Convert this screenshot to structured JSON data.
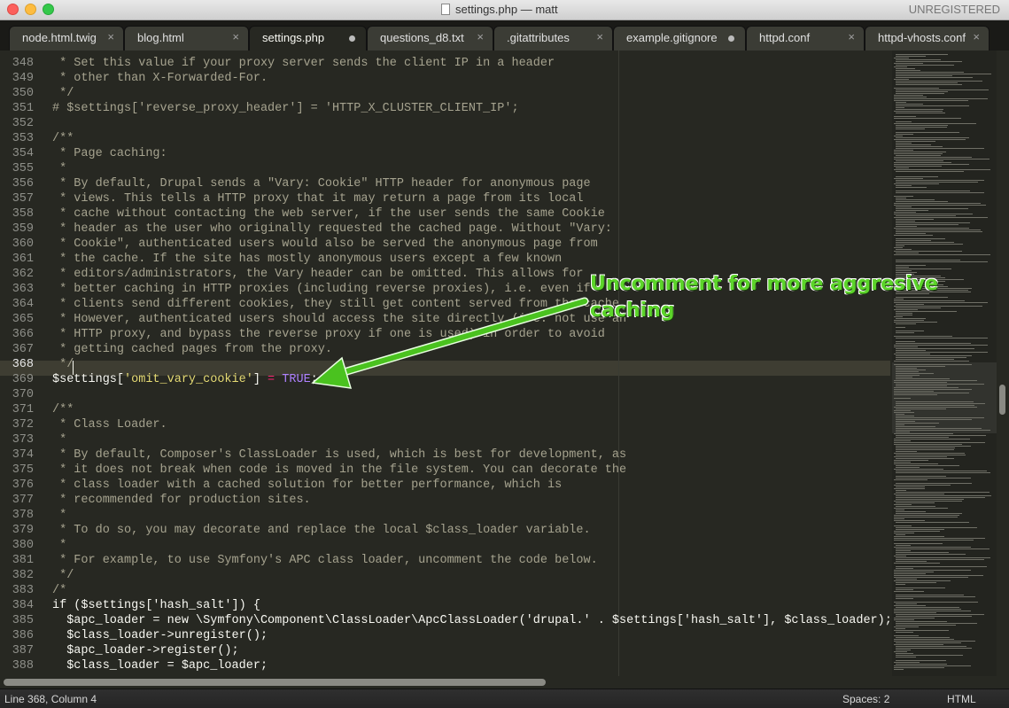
{
  "window": {
    "title": "settings.php — matt",
    "license": "UNREGISTERED"
  },
  "tabs": [
    {
      "label": "node.html.twig",
      "state": "close"
    },
    {
      "label": "blog.html",
      "state": "close"
    },
    {
      "label": "settings.php",
      "state": "modified"
    },
    {
      "label": "questions_d8.txt",
      "state": "close"
    },
    {
      "label": ".gitattributes",
      "state": "close"
    },
    {
      "label": "example.gitignore",
      "state": "modified"
    },
    {
      "label": "httpd.conf",
      "state": "close"
    },
    {
      "label": "httpd-vhosts.conf",
      "state": "close"
    }
  ],
  "editor": {
    "current_line": 368,
    "lines": [
      {
        "n": "348",
        "t": " * Set this value if your proxy server sends the client IP in a header"
      },
      {
        "n": "349",
        "t": " * other than X-Forwarded-For."
      },
      {
        "n": "350",
        "t": " */"
      },
      {
        "n": "351",
        "t": "# $settings['reverse_proxy_header'] = 'HTTP_X_CLUSTER_CLIENT_IP';"
      },
      {
        "n": "352",
        "t": ""
      },
      {
        "n": "353",
        "t": "/**"
      },
      {
        "n": "354",
        "t": " * Page caching:"
      },
      {
        "n": "355",
        "t": " *"
      },
      {
        "n": "356",
        "t": " * By default, Drupal sends a \"Vary: Cookie\" HTTP header for anonymous page"
      },
      {
        "n": "357",
        "t": " * views. This tells a HTTP proxy that it may return a page from its local"
      },
      {
        "n": "358",
        "t": " * cache without contacting the web server, if the user sends the same Cookie"
      },
      {
        "n": "359",
        "t": " * header as the user who originally requested the cached page. Without \"Vary:"
      },
      {
        "n": "360",
        "t": " * Cookie\", authenticated users would also be served the anonymous page from"
      },
      {
        "n": "361",
        "t": " * the cache. If the site has mostly anonymous users except a few known"
      },
      {
        "n": "362",
        "t": " * editors/administrators, the Vary header can be omitted. This allows for"
      },
      {
        "n": "363",
        "t": " * better caching in HTTP proxies (including reverse proxies), i.e. even if"
      },
      {
        "n": "364",
        "t": " * clients send different cookies, they still get content served from the cache."
      },
      {
        "n": "365",
        "t": " * However, authenticated users should access the site directly (i.e. not use an"
      },
      {
        "n": "366",
        "t": " * HTTP proxy, and bypass the reverse proxy if one is used) in order to avoid"
      },
      {
        "n": "367",
        "t": " * getting cached pages from the proxy."
      },
      {
        "n": "368",
        "t": " */"
      },
      {
        "n": "369",
        "code": true,
        "var": "$settings[",
        "str": "'omit_vary_cookie'",
        "close": "] ",
        "op": "=",
        "val": "TRUE",
        "end": ";"
      },
      {
        "n": "370",
        "t": ""
      },
      {
        "n": "371",
        "t": "/**"
      },
      {
        "n": "372",
        "t": " * Class Loader."
      },
      {
        "n": "373",
        "t": " *"
      },
      {
        "n": "374",
        "t": " * By default, Composer's ClassLoader is used, which is best for development, as"
      },
      {
        "n": "375",
        "t": " * it does not break when code is moved in the file system. You can decorate the"
      },
      {
        "n": "376",
        "t": " * class loader with a cached solution for better performance, which is"
      },
      {
        "n": "377",
        "t": " * recommended for production sites."
      },
      {
        "n": "378",
        "t": " *"
      },
      {
        "n": "379",
        "t": " * To do so, you may decorate and replace the local $class_loader variable."
      },
      {
        "n": "380",
        "t": " *"
      },
      {
        "n": "381",
        "t": " * For example, to use Symfony's APC class loader, uncomment the code below."
      },
      {
        "n": "382",
        "t": " */"
      },
      {
        "n": "383",
        "t": "/*"
      },
      {
        "n": "384",
        "t": "if ($settings['hash_salt']) {"
      },
      {
        "n": "385",
        "t": "  $apc_loader = new \\Symfony\\Component\\ClassLoader\\ApcClassLoader('drupal.' . $settings['hash_salt'], $class_loader);"
      },
      {
        "n": "386",
        "t": "  $class_loader->unregister();"
      },
      {
        "n": "387",
        "t": "  $apc_loader->register();"
      },
      {
        "n": "388",
        "t": "  $class_loader = $apc_loader;"
      }
    ]
  },
  "annotation": {
    "text": "Uncomment for more aggresive caching",
    "color": "#5cd42a"
  },
  "statusbar": {
    "position": "Line 368, Column 4",
    "indent": "Spaces: 2",
    "syntax": "HTML"
  }
}
